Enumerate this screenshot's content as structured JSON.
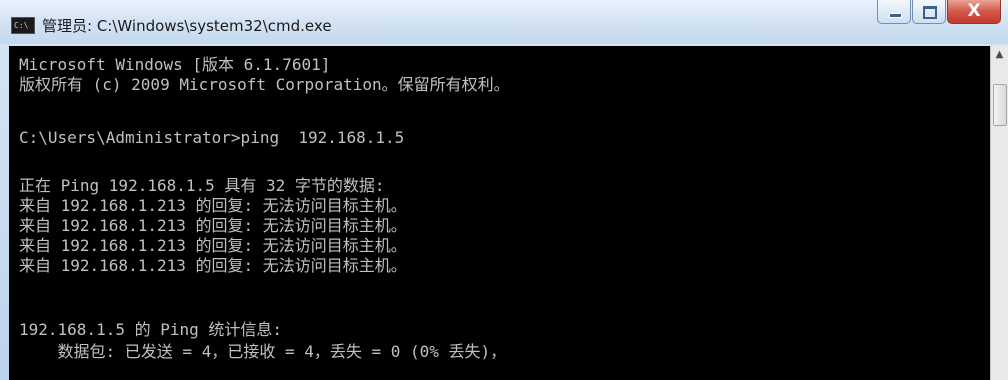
{
  "window": {
    "title": "管理员: C:\\Windows\\system32\\cmd.exe",
    "icon": "cmd-icon",
    "icon_text": "C:\\"
  },
  "controls": {
    "minimize": "minimize-icon",
    "maximize": "maximize-icon",
    "close": "close-icon",
    "close_glyph": "X"
  },
  "console": {
    "lines": [
      "Microsoft Windows [版本 6.1.7601]",
      "版权所有 (c) 2009 Microsoft Corporation。保留所有权利。",
      "",
      "C:\\Users\\Administrator>ping  192.168.1.5",
      "",
      "正在 Ping 192.168.1.5 具有 32 字节的数据:",
      "来自 192.168.1.213 的回复: 无法访问目标主机。",
      "来自 192.168.1.213 的回复: 无法访问目标主机。",
      "来自 192.168.1.213 的回复: 无法访问目标主机。",
      "来自 192.168.1.213 的回复: 无法访问目标主机。",
      "",
      "192.168.1.5 的 Ping 统计信息:",
      "    数据包: 已发送 = 4，已接收 = 4，丢失 = 0 (0% 丢失)，"
    ]
  },
  "scrollbar": {
    "up_arrow": "scroll-up-icon",
    "up_glyph": "▲"
  },
  "colors": {
    "console_bg": "#000000",
    "console_text": "#c0c0c0",
    "close_button": "#c33b2c"
  }
}
